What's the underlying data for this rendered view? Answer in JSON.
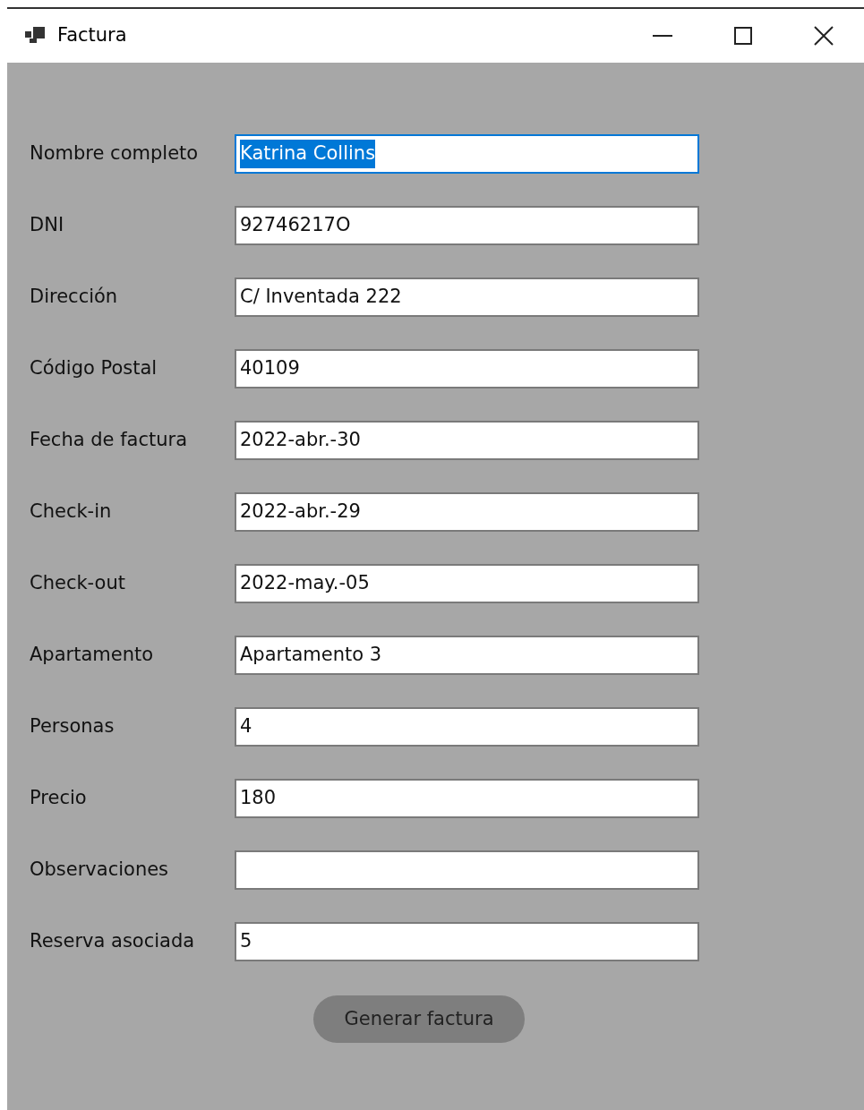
{
  "window": {
    "title": "Factura"
  },
  "fields": [
    {
      "label": "Nombre completo",
      "value": "Katrina Collins",
      "focused": true
    },
    {
      "label": "DNI",
      "value": "92746217O",
      "focused": false
    },
    {
      "label": "Dirección",
      "value": "C/ Inventada 222",
      "focused": false
    },
    {
      "label": "Código Postal",
      "value": "40109",
      "focused": false
    },
    {
      "label": "Fecha de factura",
      "value": "2022-abr.-30",
      "focused": false
    },
    {
      "label": "Check-in",
      "value": "2022-abr.-29",
      "focused": false
    },
    {
      "label": "Check-out",
      "value": "2022-may.-05",
      "focused": false
    },
    {
      "label": "Apartamento",
      "value": "Apartamento 3",
      "focused": false
    },
    {
      "label": "Personas",
      "value": "4",
      "focused": false
    },
    {
      "label": "Precio",
      "value": "180",
      "focused": false
    },
    {
      "label": "Observaciones",
      "focused": false
    },
    {
      "label": "Reserva asociada",
      "value": "5",
      "focused": false
    }
  ],
  "button": {
    "label": "Generar factura"
  }
}
